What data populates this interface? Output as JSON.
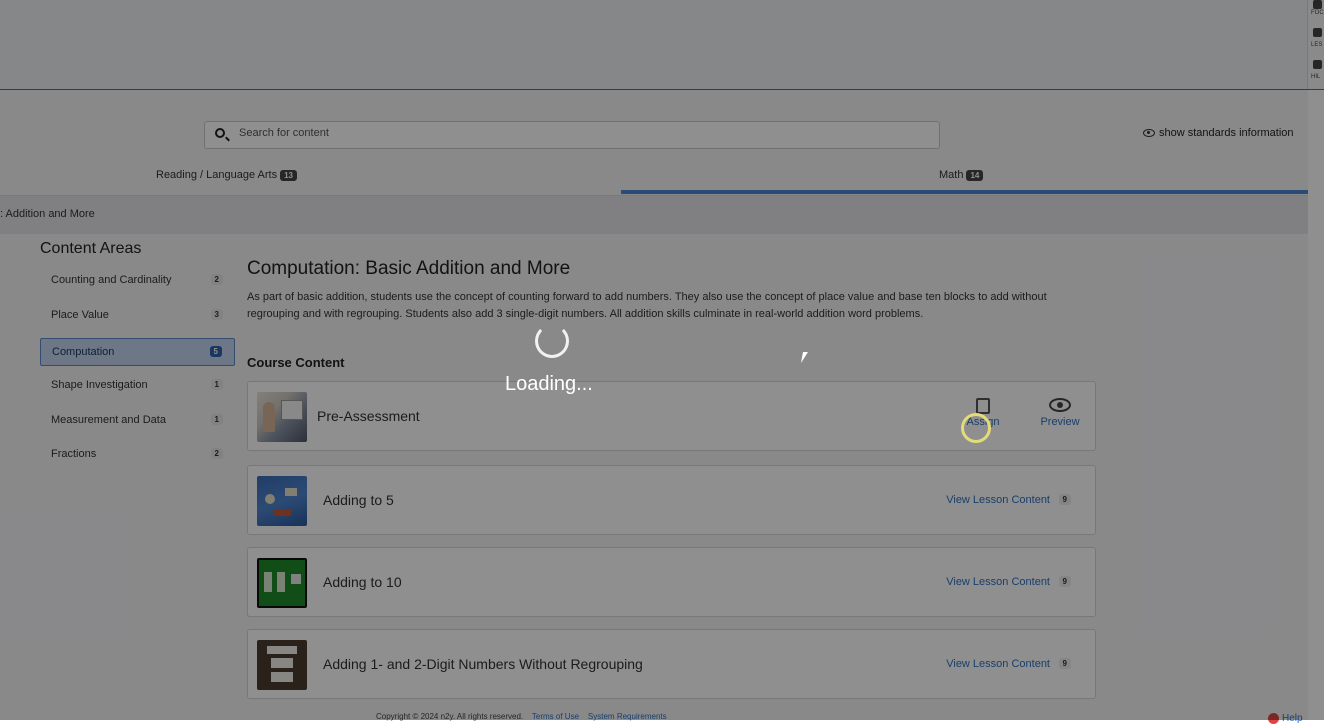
{
  "rail": {
    "items": [
      "FOC",
      "LES",
      "HIL"
    ]
  },
  "search": {
    "placeholder": "Search for content"
  },
  "standards_toggle": "show standards information",
  "tabs": [
    {
      "label": "Reading / Language Arts",
      "count": "13"
    },
    {
      "label": "Math",
      "count": "14"
    }
  ],
  "breadcrumb": ": Addition and More",
  "sidebar": {
    "title": "Content Areas",
    "items": [
      {
        "label": "Counting and Cardinality",
        "count": "2"
      },
      {
        "label": "Place Value",
        "count": "3"
      },
      {
        "label": "Computation",
        "count": "5"
      },
      {
        "label": "Shape Investigation",
        "count": "1"
      },
      {
        "label": "Measurement and Data",
        "count": "1"
      },
      {
        "label": "Fractions",
        "count": "2"
      }
    ]
  },
  "main": {
    "title": "Computation: Basic Addition and More",
    "description": "As part of basic addition, students use the concept of counting forward to add numbers. They also use the concept of place value and base ten blocks to add without regrouping and with regrouping. Students also add 3 single-digit numbers. All addition skills culminate in real-world addition word problems.",
    "course_heading": "Course Content",
    "cards": [
      {
        "title": "Pre-Assessment",
        "assign_label": "Assign",
        "preview_label": "Preview"
      },
      {
        "title": "Adding to 5",
        "link": "View Lesson Content",
        "count": "9"
      },
      {
        "title": "Adding to 10",
        "link": "View Lesson Content",
        "count": "9"
      },
      {
        "title": "Adding 1- and 2-Digit Numbers Without Regrouping",
        "link": "View Lesson Content",
        "count": "9"
      }
    ]
  },
  "footer": {
    "copyright": "Copyright © 2024 n2y. All rights reserved.",
    "terms": "Terms of Use",
    "system": "System Requirements",
    "help": "Help"
  },
  "loading_text": "Loading..."
}
